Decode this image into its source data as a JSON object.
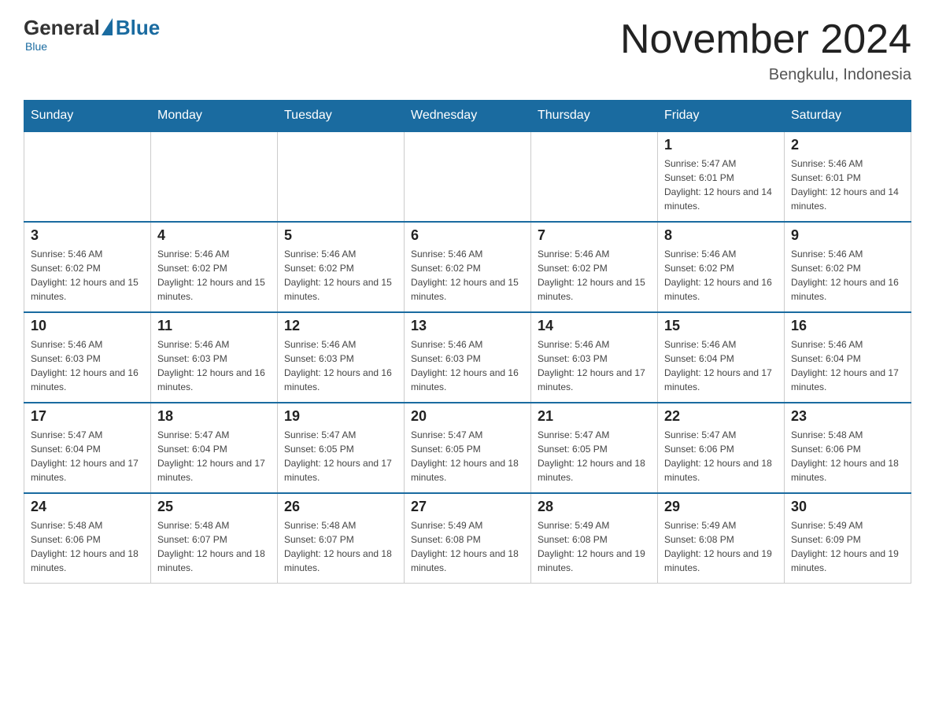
{
  "header": {
    "logo_general": "General",
    "logo_blue": "Blue",
    "month_title": "November 2024",
    "location": "Bengkulu, Indonesia"
  },
  "days_of_week": [
    "Sunday",
    "Monday",
    "Tuesday",
    "Wednesday",
    "Thursday",
    "Friday",
    "Saturday"
  ],
  "weeks": [
    [
      {
        "day": "",
        "info": ""
      },
      {
        "day": "",
        "info": ""
      },
      {
        "day": "",
        "info": ""
      },
      {
        "day": "",
        "info": ""
      },
      {
        "day": "",
        "info": ""
      },
      {
        "day": "1",
        "info": "Sunrise: 5:47 AM\nSunset: 6:01 PM\nDaylight: 12 hours and 14 minutes."
      },
      {
        "day": "2",
        "info": "Sunrise: 5:46 AM\nSunset: 6:01 PM\nDaylight: 12 hours and 14 minutes."
      }
    ],
    [
      {
        "day": "3",
        "info": "Sunrise: 5:46 AM\nSunset: 6:02 PM\nDaylight: 12 hours and 15 minutes."
      },
      {
        "day": "4",
        "info": "Sunrise: 5:46 AM\nSunset: 6:02 PM\nDaylight: 12 hours and 15 minutes."
      },
      {
        "day": "5",
        "info": "Sunrise: 5:46 AM\nSunset: 6:02 PM\nDaylight: 12 hours and 15 minutes."
      },
      {
        "day": "6",
        "info": "Sunrise: 5:46 AM\nSunset: 6:02 PM\nDaylight: 12 hours and 15 minutes."
      },
      {
        "day": "7",
        "info": "Sunrise: 5:46 AM\nSunset: 6:02 PM\nDaylight: 12 hours and 15 minutes."
      },
      {
        "day": "8",
        "info": "Sunrise: 5:46 AM\nSunset: 6:02 PM\nDaylight: 12 hours and 16 minutes."
      },
      {
        "day": "9",
        "info": "Sunrise: 5:46 AM\nSunset: 6:02 PM\nDaylight: 12 hours and 16 minutes."
      }
    ],
    [
      {
        "day": "10",
        "info": "Sunrise: 5:46 AM\nSunset: 6:03 PM\nDaylight: 12 hours and 16 minutes."
      },
      {
        "day": "11",
        "info": "Sunrise: 5:46 AM\nSunset: 6:03 PM\nDaylight: 12 hours and 16 minutes."
      },
      {
        "day": "12",
        "info": "Sunrise: 5:46 AM\nSunset: 6:03 PM\nDaylight: 12 hours and 16 minutes."
      },
      {
        "day": "13",
        "info": "Sunrise: 5:46 AM\nSunset: 6:03 PM\nDaylight: 12 hours and 16 minutes."
      },
      {
        "day": "14",
        "info": "Sunrise: 5:46 AM\nSunset: 6:03 PM\nDaylight: 12 hours and 17 minutes."
      },
      {
        "day": "15",
        "info": "Sunrise: 5:46 AM\nSunset: 6:04 PM\nDaylight: 12 hours and 17 minutes."
      },
      {
        "day": "16",
        "info": "Sunrise: 5:46 AM\nSunset: 6:04 PM\nDaylight: 12 hours and 17 minutes."
      }
    ],
    [
      {
        "day": "17",
        "info": "Sunrise: 5:47 AM\nSunset: 6:04 PM\nDaylight: 12 hours and 17 minutes."
      },
      {
        "day": "18",
        "info": "Sunrise: 5:47 AM\nSunset: 6:04 PM\nDaylight: 12 hours and 17 minutes."
      },
      {
        "day": "19",
        "info": "Sunrise: 5:47 AM\nSunset: 6:05 PM\nDaylight: 12 hours and 17 minutes."
      },
      {
        "day": "20",
        "info": "Sunrise: 5:47 AM\nSunset: 6:05 PM\nDaylight: 12 hours and 18 minutes."
      },
      {
        "day": "21",
        "info": "Sunrise: 5:47 AM\nSunset: 6:05 PM\nDaylight: 12 hours and 18 minutes."
      },
      {
        "day": "22",
        "info": "Sunrise: 5:47 AM\nSunset: 6:06 PM\nDaylight: 12 hours and 18 minutes."
      },
      {
        "day": "23",
        "info": "Sunrise: 5:48 AM\nSunset: 6:06 PM\nDaylight: 12 hours and 18 minutes."
      }
    ],
    [
      {
        "day": "24",
        "info": "Sunrise: 5:48 AM\nSunset: 6:06 PM\nDaylight: 12 hours and 18 minutes."
      },
      {
        "day": "25",
        "info": "Sunrise: 5:48 AM\nSunset: 6:07 PM\nDaylight: 12 hours and 18 minutes."
      },
      {
        "day": "26",
        "info": "Sunrise: 5:48 AM\nSunset: 6:07 PM\nDaylight: 12 hours and 18 minutes."
      },
      {
        "day": "27",
        "info": "Sunrise: 5:49 AM\nSunset: 6:08 PM\nDaylight: 12 hours and 18 minutes."
      },
      {
        "day": "28",
        "info": "Sunrise: 5:49 AM\nSunset: 6:08 PM\nDaylight: 12 hours and 19 minutes."
      },
      {
        "day": "29",
        "info": "Sunrise: 5:49 AM\nSunset: 6:08 PM\nDaylight: 12 hours and 19 minutes."
      },
      {
        "day": "30",
        "info": "Sunrise: 5:49 AM\nSunset: 6:09 PM\nDaylight: 12 hours and 19 minutes."
      }
    ]
  ]
}
